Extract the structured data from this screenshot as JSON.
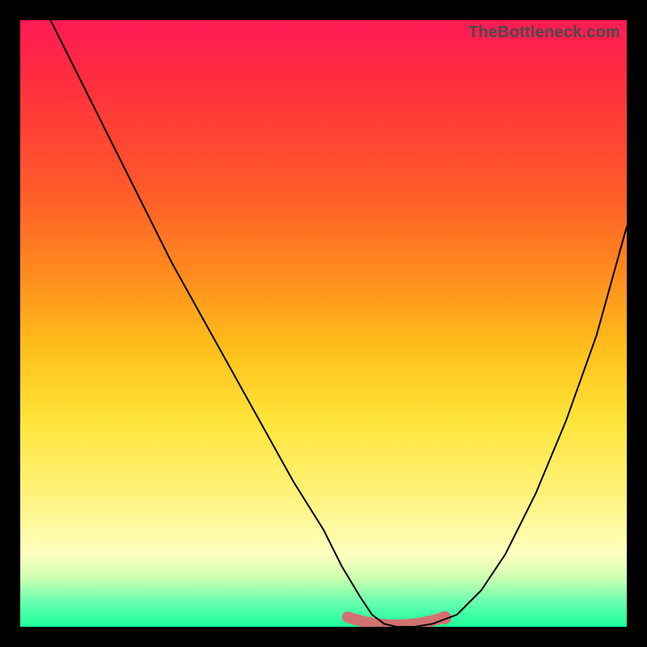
{
  "watermark": "TheBottleneck.com",
  "colors": {
    "frame_bg": "#000000",
    "curve": "#000000",
    "optimal_band": "#d96a6e",
    "gradient_top": "#ff1a55",
    "gradient_bottom": "#1aff99"
  },
  "chart_data": {
    "type": "line",
    "title": "",
    "xlabel": "",
    "ylabel": "",
    "xlim": [
      0,
      100
    ],
    "ylim": [
      0,
      100
    ],
    "grid": false,
    "legend": false,
    "description": "Bottleneck curve: percentage bottleneck (y) vs relative hardware power (x). Minimum ~0% in the optimal band.",
    "series": [
      {
        "name": "bottleneck_percent",
        "x": [
          5,
          10,
          15,
          20,
          25,
          30,
          35,
          40,
          45,
          50,
          53,
          56,
          58,
          60,
          62,
          65,
          68,
          72,
          76,
          80,
          85,
          90,
          95,
          100
        ],
        "y": [
          100,
          90,
          80,
          70,
          60,
          51,
          42,
          33,
          24,
          16,
          10,
          5,
          2,
          0.5,
          0,
          0,
          0.5,
          2,
          6,
          12,
          22,
          34,
          48,
          66
        ]
      }
    ],
    "optimal_band": {
      "x_start": 54,
      "x_end": 70,
      "y": 0
    },
    "marker": {
      "x": 70,
      "y": 1.5
    }
  }
}
